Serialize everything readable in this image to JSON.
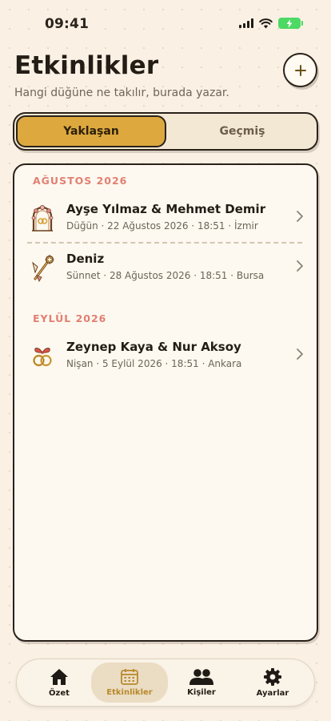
{
  "status_bar": {
    "time": "09:41"
  },
  "header": {
    "title": "Etkinlikler",
    "subtitle": "Hangi düğüne ne takılır, burada yazar."
  },
  "segmented": {
    "options": [
      {
        "label": "Yaklaşan",
        "selected": true
      },
      {
        "label": "Geçmiş",
        "selected": false
      }
    ]
  },
  "sections": [
    {
      "header": "AĞUSTOS 2026",
      "events": [
        {
          "title": "Ayşe Yılmaz & Mehmet Demir",
          "meta": "Düğün · 22 Ağustos 2026 · 18:51 · İzmir",
          "icon": "wedding-arch-icon"
        },
        {
          "title": "Deniz",
          "meta": "Sünnet · 28 Ağustos 2026 · 18:51 · Bursa",
          "icon": "sunnet-scepter-icon"
        }
      ]
    },
    {
      "header": "EYLÜL 2026",
      "events": [
        {
          "title": "Zeynep Kaya & Nur Aksoy",
          "meta": "Nişan · 5 Eylül 2026 · 18:51 · Ankara",
          "icon": "engagement-rings-icon"
        }
      ]
    }
  ],
  "tab_bar": {
    "tabs": [
      {
        "label": "Özet",
        "icon": "home-icon",
        "active": false
      },
      {
        "label": "Etkinlikler",
        "icon": "calendar-icon",
        "active": true
      },
      {
        "label": "Kişiler",
        "icon": "people-icon",
        "active": false
      },
      {
        "label": "Ayarlar",
        "icon": "gear-icon",
        "active": false
      }
    ]
  },
  "colors": {
    "background": "#faf1e4",
    "accent": "#dda93f",
    "section_header": "#e27f72",
    "active_tab": "#b88a2a"
  }
}
